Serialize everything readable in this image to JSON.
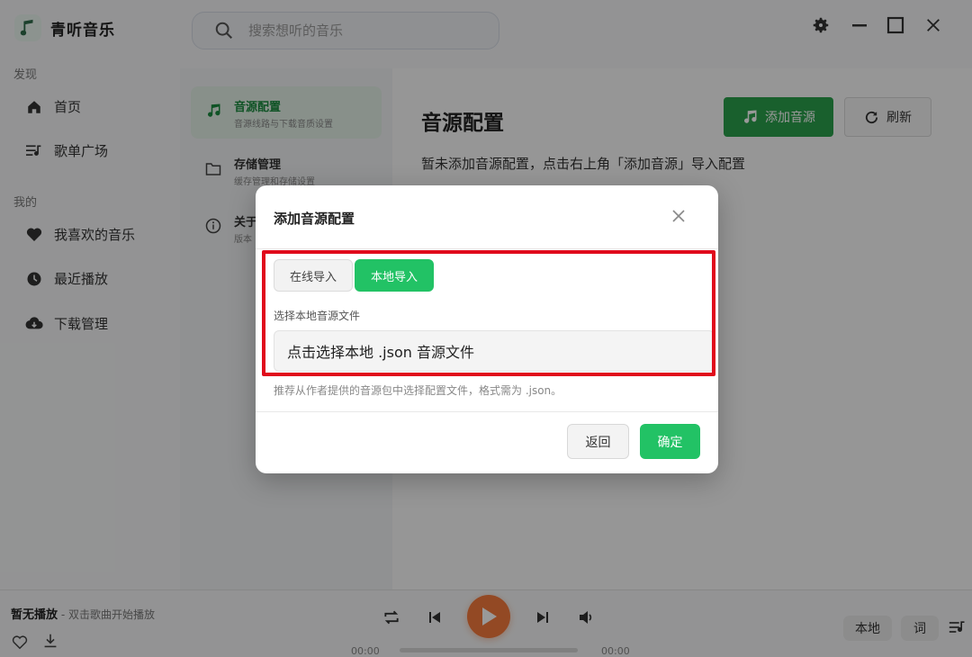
{
  "app": {
    "name": "青听音乐"
  },
  "search": {
    "placeholder": "搜索想听的音乐"
  },
  "sidebar": {
    "section_discover": "发现",
    "section_mine": "我的",
    "items": [
      {
        "label": "首页",
        "icon": "home-icon"
      },
      {
        "label": "歌单广场",
        "icon": "playlist-icon"
      },
      {
        "label": "我喜欢的音乐",
        "icon": "heart-icon"
      },
      {
        "label": "最近播放",
        "icon": "clock-icon"
      },
      {
        "label": "下载管理",
        "icon": "cloud-download-icon"
      }
    ]
  },
  "settings_nav": [
    {
      "title": "音源配置",
      "subtitle": "音源线路与下载音质设置",
      "icon": "music-note-icon",
      "active": true
    },
    {
      "title": "存储管理",
      "subtitle": "缓存管理和存储设置",
      "icon": "folder-icon",
      "active": false
    },
    {
      "title": "关于",
      "subtitle": "版本",
      "icon": "info-icon",
      "active": false
    }
  ],
  "content": {
    "title": "音源配置",
    "empty_hint": "暂未添加音源配置，点击右上角「添加音源」导入配置",
    "add_button": "添加音源",
    "refresh_button": "刷新"
  },
  "modal": {
    "title": "添加音源配置",
    "tabs": [
      {
        "label": "在线导入",
        "active": false
      },
      {
        "label": "本地导入",
        "active": true
      }
    ],
    "field_label": "选择本地音源文件",
    "file_picker_text": "点击选择本地 .json 音源文件",
    "help_text": "推荐从作者提供的音源包中选择配置文件，格式需为 .json。",
    "back_button": "返回",
    "confirm_button": "确定"
  },
  "player": {
    "title": "暂无播放",
    "subtitle": " - 双击歌曲开始播放",
    "time_current": "00:00",
    "time_total": "00:00",
    "progress": 0,
    "local_button": "本地",
    "lyrics_button": "词"
  },
  "colors": {
    "accent_green": "#22c265",
    "button_green": "#2ba14b",
    "play_orange": "#f57a3c",
    "highlight_red": "#e00b1c"
  }
}
